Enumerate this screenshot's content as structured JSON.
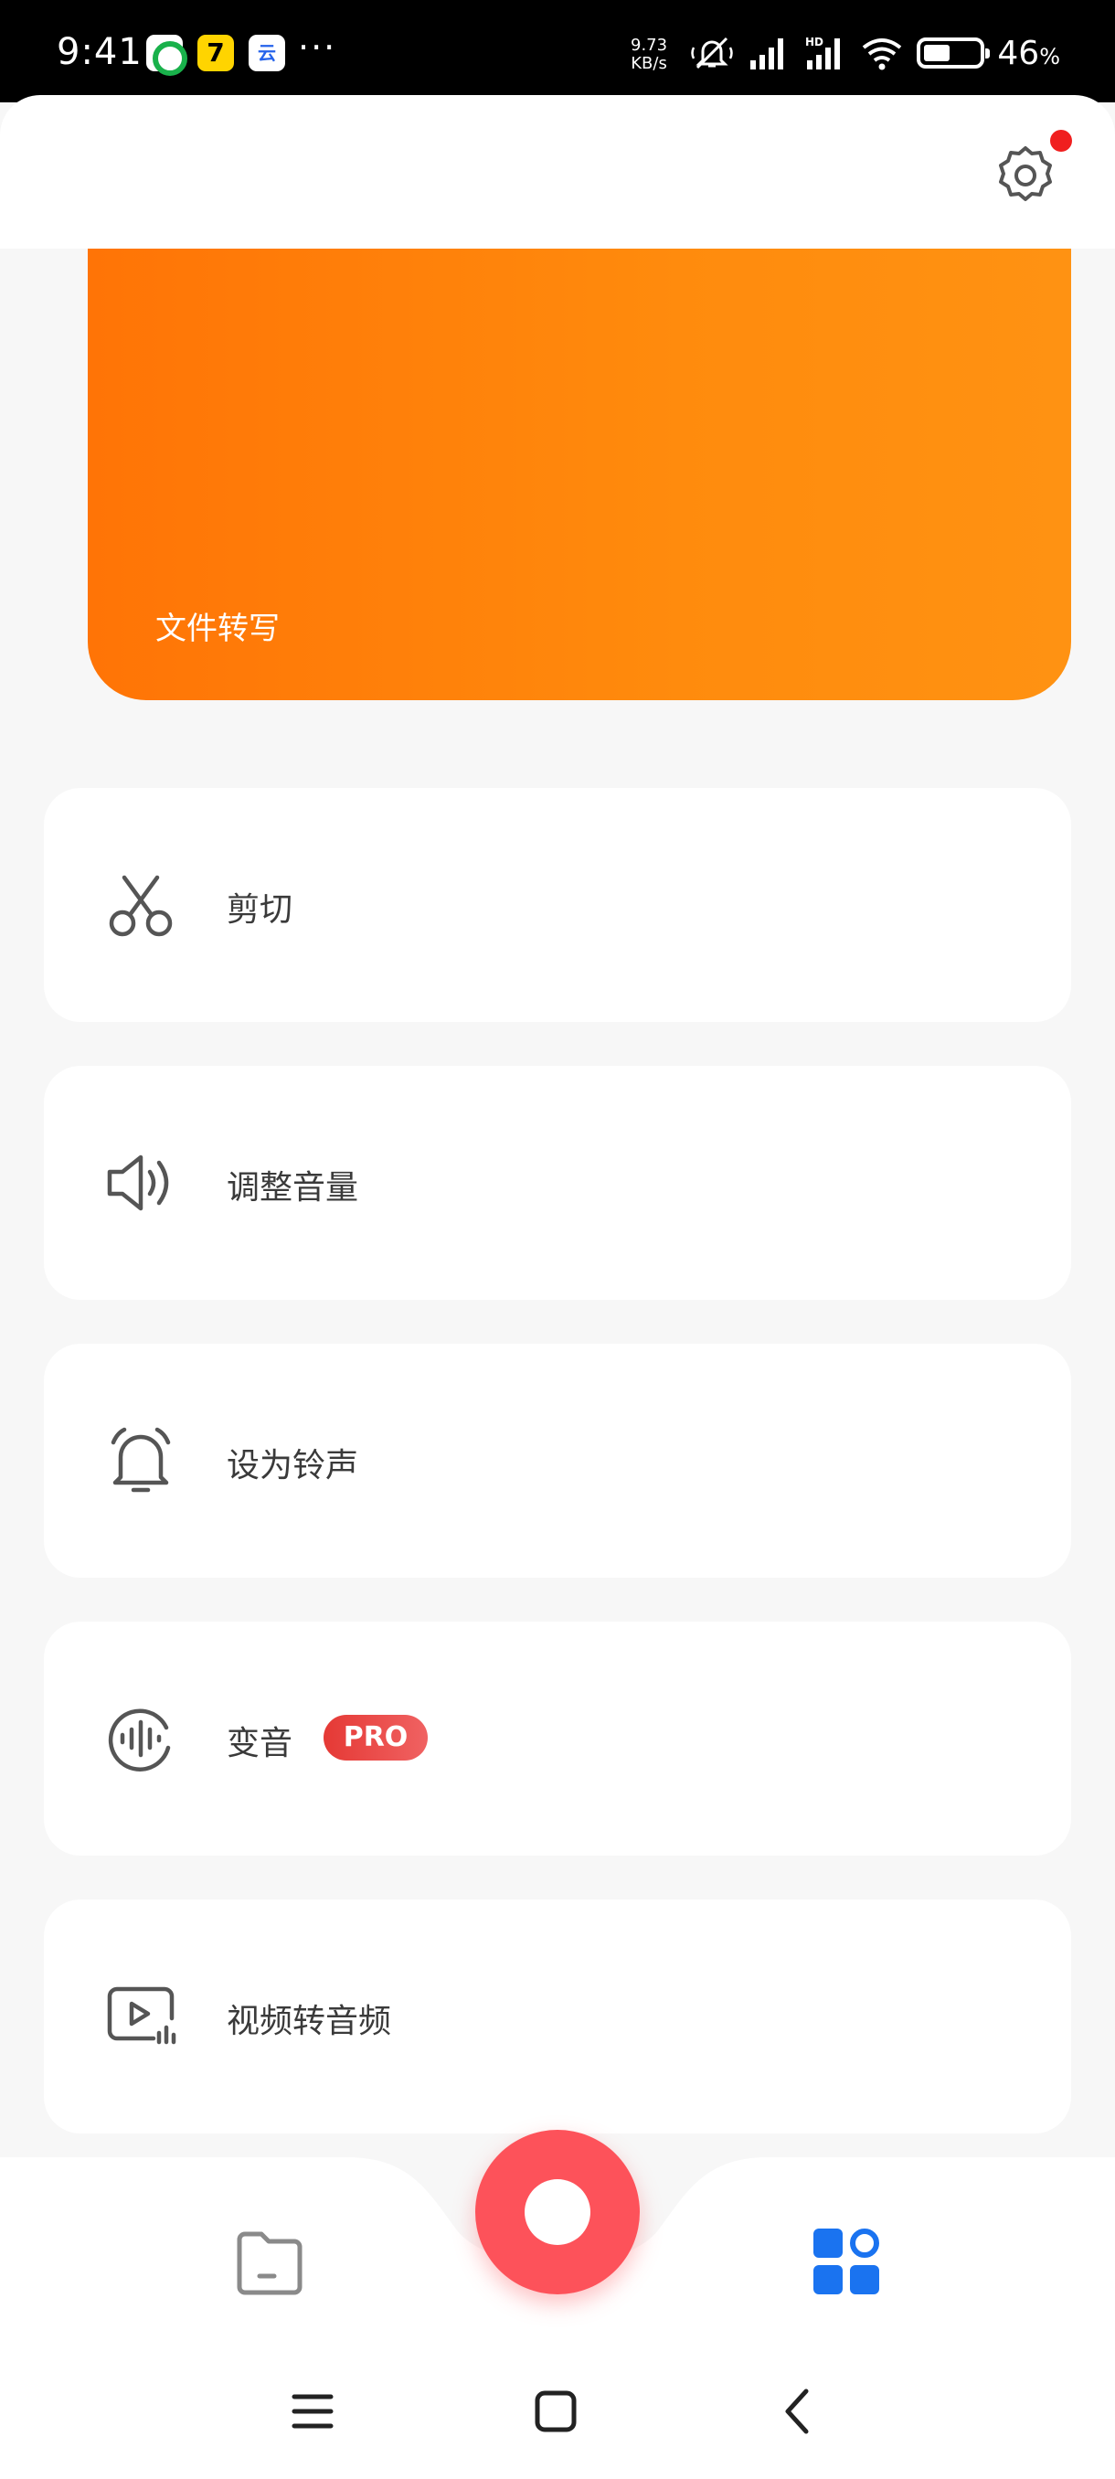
{
  "status_bar": {
    "time": "9:41",
    "speed_value": "9.73",
    "speed_unit": "KB/s",
    "battery_percent": "46",
    "battery_unit": "%"
  },
  "header": {
    "settings_icon": "gear-icon",
    "has_notification": true
  },
  "banner": {
    "label": "文件转写",
    "color_start": "#ff7406",
    "color_end": "#ff9212"
  },
  "tools": [
    {
      "label": "剪切",
      "icon": "scissors-icon"
    },
    {
      "label": "调整音量",
      "icon": "volume-icon"
    },
    {
      "label": "设为铃声",
      "icon": "bell-icon"
    },
    {
      "label": "变音",
      "icon": "waveform-icon",
      "badge": "PRO"
    },
    {
      "label": "视频转音频",
      "icon": "video-audio-icon"
    }
  ],
  "bottom_nav": {
    "files_icon": "folder-icon",
    "record_icon": "record-icon",
    "tools_icon": "grid-icon",
    "record_color": "#fd525a",
    "active_color": "#1a73f0"
  },
  "system_nav": {
    "menu_icon": "menu-icon",
    "home_icon": "home-icon",
    "back_icon": "back-icon"
  }
}
